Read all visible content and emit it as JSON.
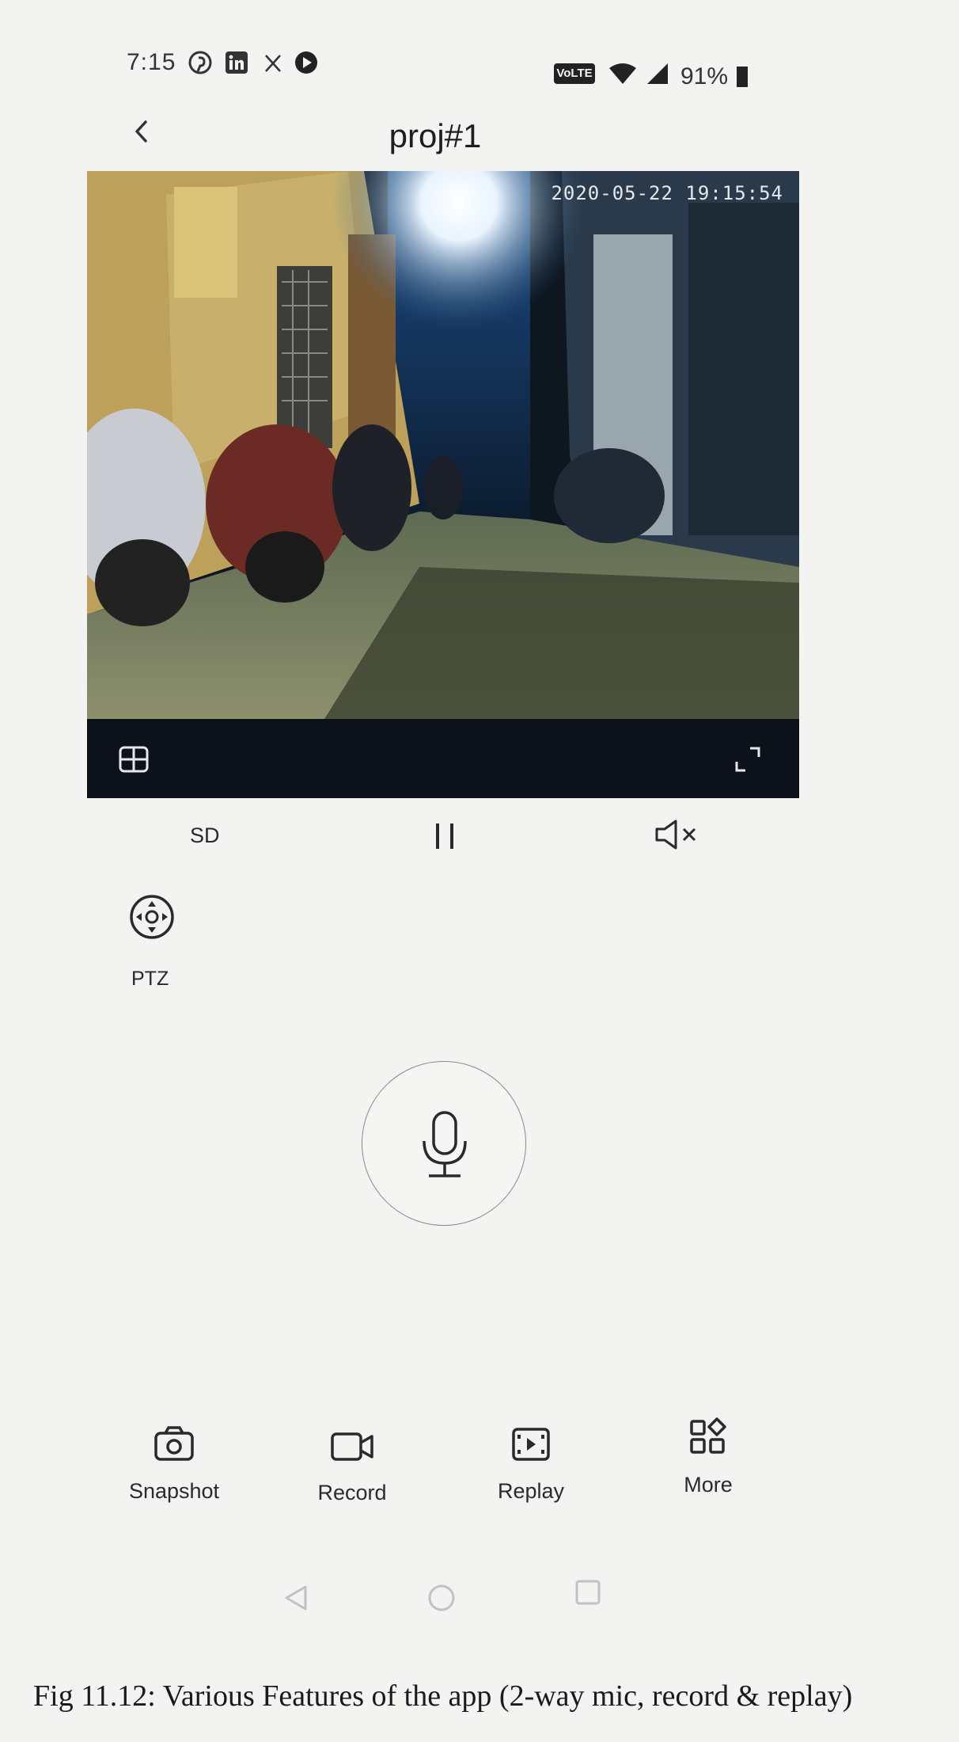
{
  "status_bar": {
    "time": "7:15",
    "battery": "91%",
    "left_icons": [
      "pinterest-icon",
      "linkedin-icon",
      "x-icon",
      "youtube-play-icon"
    ],
    "right_icons": [
      "volte-icon",
      "wifi-icon",
      "cellular-signal-icon",
      "battery-icon"
    ],
    "volte_text": "VoLTE"
  },
  "header": {
    "title": "proj#1",
    "back_icon": "chevron-left-icon"
  },
  "video": {
    "timestamp": "2020-05-22 19:15:54",
    "grid_icon": "grid-layout-icon",
    "fullscreen_icon": "fullscreen-icon"
  },
  "controls": {
    "quality": "SD",
    "pause_icon": "pause-icon",
    "mute_icon": "speaker-muted-icon"
  },
  "ptz": {
    "label": "PTZ",
    "icon": "ptz-direction-icon"
  },
  "mic": {
    "icon": "microphone-icon"
  },
  "toolbar": {
    "snapshot": "Snapshot",
    "record": "Record",
    "replay": "Replay",
    "more": "More"
  },
  "nav": {
    "icons": [
      "back-triangle-icon",
      "home-circle-icon",
      "recents-square-icon"
    ]
  },
  "caption": "Fig 11.12: Various Features of the app (2-way mic, record & replay)",
  "colors": {
    "background": "#f3f3f1",
    "text": "#2a2a2a",
    "video_bar": "#0c1219"
  }
}
